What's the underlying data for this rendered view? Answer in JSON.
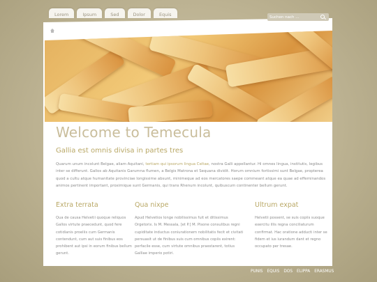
{
  "nav": {
    "tabs": [
      "Lorem",
      "Ipsum",
      "Sed",
      "Dolor",
      "Equis"
    ]
  },
  "search": {
    "placeholder": "Suchen nach ..."
  },
  "content": {
    "title": "Welcome to Temecula",
    "subtitle": "Gallia est omnis divisa in partes tres",
    "intro_before": "Quarum unum incolunt Belgae, aliam Aquitani, ",
    "intro_link": "tertiam qui ipsorum lingua Celtae",
    "intro_after": ", nostra Galli appellantur. Hi omnes lingua, institutis, legibus inter se differunt. Gallos ab Aquitanis Garumna flumen, a Belgis Matrona et Sequana dividit. Horum omnium fortissimi sunt Belgae, propterea quod a cultu atque humanitate provinciae longissime absunt, minimeque ad eos mercatores saepe commeant atque ea quae ad effeminandos animos pertinent important, proximique sunt Germanis, qui trans Rhenum incolunt, quibuscum continenter bellum gerunt."
  },
  "columns": [
    {
      "heading": "Extra terrata",
      "text": "Qua de causa Helvetii quoque reliquos Gallos virtute praecedunt, quod fere cotidianis proeliis cum Germanis contendunt, cum aut suis finibus eos prohibent aut ipsi in eorum finibus bellum gerunt."
    },
    {
      "heading": "Qua nixpe",
      "text": "Apud Helvetios longe nobilissimus fuit et ditissimus Orgetorix. Is M. Messala, [et P.] M. Pisone consulibus regni cupiditate inductus coniurationem nobilitatis fecit et civitati persuasit ut de finibus suis cum omnibus copiis exirent: perfacile esse, cum virtute omnibus praestarent, totius Galliae imperio potiri."
    },
    {
      "heading": "Ultrum expat",
      "text": "Helvetii possent, se suis copiis suoque exercitu illis regna conciliaturum confirmat. Hac oratione adducti inter se fidem et ius iurandum dant et regno occupato per tresae."
    }
  ],
  "footer": {
    "links": [
      "PUNIS",
      "EQUIS",
      "DOS",
      "ELIPPA",
      "ERASMUS"
    ]
  },
  "colors": {
    "background": "#bdb393",
    "accent": "#b9a866",
    "title": "#c9bd9b",
    "body_text": "#8c8c8c"
  }
}
